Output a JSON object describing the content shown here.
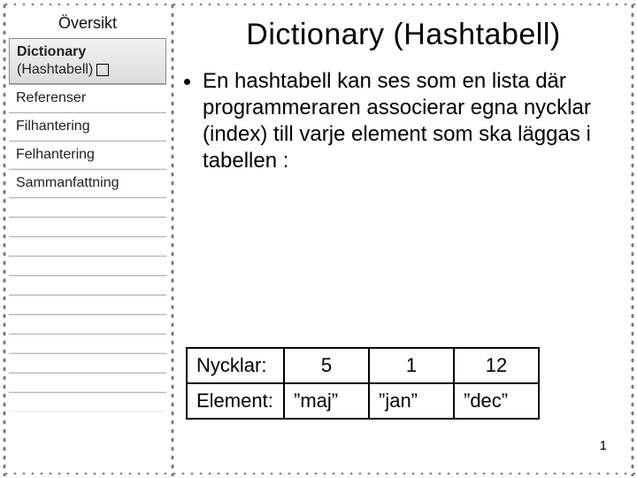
{
  "sidebar": {
    "title": "Översikt",
    "items": [
      {
        "label_line1": "Dictionary",
        "label_line2": "(Hashtabell)",
        "selected": true,
        "glyph": true
      },
      {
        "label": "Referenser"
      },
      {
        "label": "Filhantering"
      },
      {
        "label": "Felhantering"
      },
      {
        "label": "Sammanfattning"
      }
    ]
  },
  "main": {
    "title": "Dictionary (Hashtabell)",
    "bullet": "En hashtabell kan ses som en lista där programmeraren associerar egna nycklar (index) till varje element som ska läggas i tabellen :"
  },
  "table": {
    "rows": [
      {
        "hdr": "Nycklar:",
        "c1": "5",
        "c2": "1",
        "c3": "12"
      },
      {
        "hdr": "Element:",
        "c1": "”maj”",
        "c2": "”jan”",
        "c3": "”dec”"
      }
    ]
  },
  "slide_number": "1",
  "chart_data": {
    "type": "table",
    "title": "Dictionary (Hashtabell)",
    "columns": [
      "Nycklar:",
      "5",
      "1",
      "12"
    ],
    "rows": [
      [
        "Element:",
        "\"maj\"",
        "\"jan\"",
        "\"dec\""
      ]
    ]
  }
}
